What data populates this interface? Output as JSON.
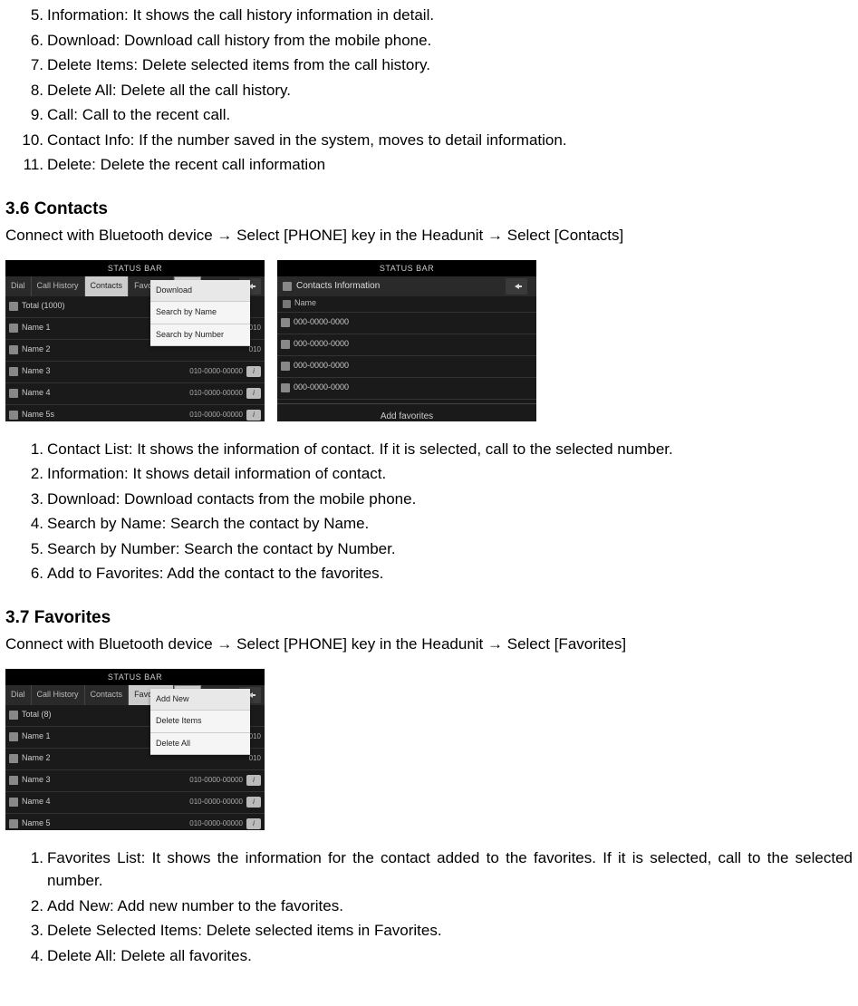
{
  "top_list": [
    {
      "n": "5.",
      "t": "Information: It shows the call history information in detail."
    },
    {
      "n": "6.",
      "t": "Download: Download call history from the mobile phone."
    },
    {
      "n": "7.",
      "t": "Delete Items: Delete selected items from the call history."
    },
    {
      "n": "8.",
      "t": "Delete All: Delete all the call history."
    },
    {
      "n": "9.",
      "t": "Call: Call to the recent call."
    },
    {
      "n": "10.",
      "t": "Contact Info: If the number saved in the system, moves to detail information."
    },
    {
      "n": "11.",
      "t": "Delete: Delete the recent call information"
    }
  ],
  "sec36": {
    "title": "3.6 Contacts",
    "instr_a": "Connect with Bluetooth device ",
    "instr_b": " Select [PHONE] key in the Headunit ",
    "instr_c": " Select [Contacts]"
  },
  "arrow": "→",
  "screen1": {
    "status": "STATUS BAR",
    "tabs": [
      "Dial",
      "Call History",
      "Contacts",
      "Favorites"
    ],
    "menu": "Menu",
    "total": "Total (1000)",
    "rows": [
      {
        "name": "Name 1",
        "num": "010"
      },
      {
        "name": "Name 2",
        "num": "010"
      },
      {
        "name": "Name 3",
        "num": "010-0000-00000"
      },
      {
        "name": "Name 4",
        "num": "010-0000-00000"
      },
      {
        "name": "Name 5s",
        "num": "010-0000-00000"
      }
    ],
    "dd": [
      "Download",
      "Search by Name",
      "Search by Number"
    ]
  },
  "screen2": {
    "status": "STATUS BAR",
    "title": "Contacts Information",
    "name_lbl": "Name",
    "nums": [
      "000-0000-0000",
      "000-0000-0000",
      "000-0000-0000",
      "000-0000-0000"
    ],
    "addfav": "Add favorites"
  },
  "list36": [
    {
      "n": "1.",
      "t": "Contact List: It shows the information of contact. If it is selected, call to the selected number."
    },
    {
      "n": "2.",
      "t": "Information: It shows detail information of contact."
    },
    {
      "n": "3.",
      "t": "Download: Download contacts from the mobile phone."
    },
    {
      "n": "4.",
      "t": "Search by Name: Search the contact by Name."
    },
    {
      "n": "5.",
      "t": "Search by Number: Search the contact by Number."
    },
    {
      "n": "6.",
      "t": "Add to Favorites: Add the contact to the favorites."
    }
  ],
  "sec37": {
    "title": "3.7 Favorites",
    "instr_a": "Connect with Bluetooth device ",
    "instr_b": " Select [PHONE] key in the Headunit ",
    "instr_c": " Select [Favorites]"
  },
  "screen3": {
    "status": "STATUS BAR",
    "tabs": [
      "Dial",
      "Call History",
      "Contacts",
      "Favorites"
    ],
    "menu": "Menu",
    "total": "Total (8)",
    "rows": [
      {
        "name": "Name 1",
        "num": "010"
      },
      {
        "name": "Name 2",
        "num": "010"
      },
      {
        "name": "Name 3",
        "num": "010-0000-00000"
      },
      {
        "name": "Name 4",
        "num": "010-0000-00000"
      },
      {
        "name": "Name 5",
        "num": "010-0000-00000"
      }
    ],
    "dd": [
      "Add New",
      "Delete Items",
      "Delete All"
    ]
  },
  "list37": [
    {
      "n": "1.",
      "t": "Favorites List: It shows the information for the contact added to the favorites. If it is selected, call to the selected number."
    },
    {
      "n": "2.",
      "t": "Add New: Add new number to the favorites."
    },
    {
      "n": "3.",
      "t": "Delete Selected Items: Delete selected items in Favorites."
    },
    {
      "n": "4.",
      "t": "Delete All: Delete all favorites."
    }
  ]
}
